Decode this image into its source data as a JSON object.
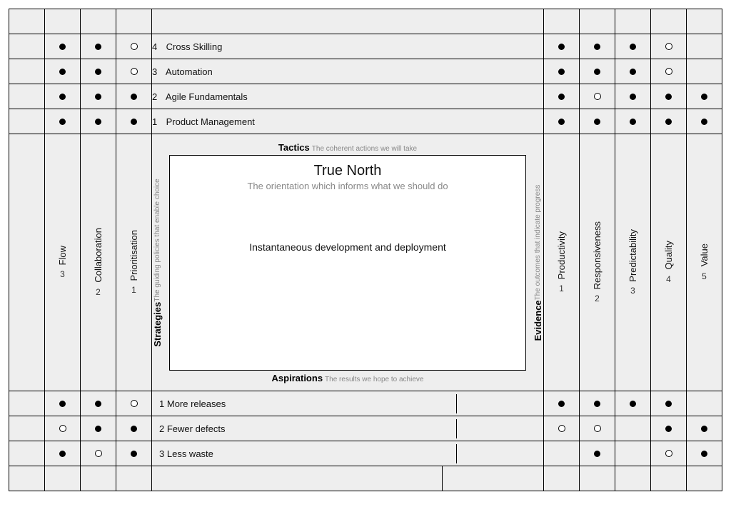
{
  "strategies": [
    {
      "num": "3",
      "name": "Flow"
    },
    {
      "num": "2",
      "name": "Collaboration"
    },
    {
      "num": "1",
      "name": "Prioritisation"
    }
  ],
  "evidence": [
    {
      "num": "1",
      "name": "Productivity"
    },
    {
      "num": "2",
      "name": "Responsiveness"
    },
    {
      "num": "3",
      "name": "Predictability"
    },
    {
      "num": "4",
      "name": "Quality"
    },
    {
      "num": "5",
      "name": "Value"
    }
  ],
  "tactics": [
    {
      "num": "4",
      "label": "Cross Skilling",
      "s": [
        "",
        "f",
        "f",
        "r"
      ],
      "e": [
        "f",
        "f",
        "f",
        "r",
        ""
      ]
    },
    {
      "num": "3",
      "label": "Automation",
      "s": [
        "",
        "f",
        "f",
        "r"
      ],
      "e": [
        "f",
        "f",
        "f",
        "r",
        ""
      ]
    },
    {
      "num": "2",
      "label": "Agile Fundamentals",
      "s": [
        "",
        "f",
        "f",
        "f"
      ],
      "e": [
        "f",
        "r",
        "f",
        "f",
        "f"
      ]
    },
    {
      "num": "1",
      "label": "Product Management",
      "s": [
        "",
        "f",
        "f",
        "f"
      ],
      "e": [
        "f",
        "f",
        "f",
        "f",
        "f"
      ]
    }
  ],
  "aspirations": [
    {
      "num": "1",
      "label": "More releases",
      "s": [
        "",
        "f",
        "f",
        "r"
      ],
      "e": [
        "f",
        "f",
        "f",
        "f",
        ""
      ]
    },
    {
      "num": "2",
      "label": "Fewer defects",
      "s": [
        "",
        "r",
        "f",
        "f"
      ],
      "e": [
        "r",
        "r",
        "",
        "f",
        "f"
      ]
    },
    {
      "num": "3",
      "label": "Less waste",
      "s": [
        "",
        "f",
        "r",
        "f"
      ],
      "e": [
        "",
        "f",
        "",
        "r",
        "f"
      ]
    }
  ],
  "edges": {
    "top": {
      "title": "Tactics",
      "sub": "The coherent actions we will take"
    },
    "left": {
      "title": "Strategies",
      "sub": "The guiding policies that enable choice"
    },
    "right": {
      "title": "Evidence",
      "sub": "The outcomes that indicate progress"
    },
    "bottom": {
      "title": "Aspirations",
      "sub": "The results we hope to achieve"
    }
  },
  "true_north": {
    "title": "True North",
    "subtitle": "The orientation which informs what we should do",
    "body": "Instantaneous development and deployment"
  },
  "chart_data": {
    "type": "table",
    "description": "X-matrix diagram. Filled dot = strong correlation, ring = weak correlation, blank = none.",
    "strategies": [
      "Flow",
      "Collaboration",
      "Prioritisation"
    ],
    "evidence": [
      "Productivity",
      "Responsiveness",
      "Predictability",
      "Quality",
      "Value"
    ],
    "tactics": {
      "Cross Skilling": {
        "strategies": {
          "Flow": null,
          "Collaboration": "strong",
          "Prioritisation": "strong",
          "_extra": "weak_rightmost"
        },
        "s_raw": [
          "",
          "strong",
          "strong",
          "weak"
        ],
        "evidence": {
          "Productivity": "strong",
          "Responsiveness": "strong",
          "Predictability": "strong",
          "Quality": "weak",
          "Value": null
        }
      },
      "Automation": {
        "s_raw": [
          "",
          "strong",
          "strong",
          "weak"
        ],
        "evidence": {
          "Productivity": "strong",
          "Responsiveness": "strong",
          "Predictability": "strong",
          "Quality": "weak",
          "Value": null
        }
      },
      "Agile Fundamentals": {
        "s_raw": [
          "",
          "strong",
          "strong",
          "strong"
        ],
        "evidence": {
          "Productivity": "strong",
          "Responsiveness": "weak",
          "Predictability": "strong",
          "Quality": "strong",
          "Value": "strong"
        }
      },
      "Product Management": {
        "s_raw": [
          "",
          "strong",
          "strong",
          "strong"
        ],
        "evidence": {
          "Productivity": "strong",
          "Responsiveness": "strong",
          "Predictability": "strong",
          "Quality": "strong",
          "Value": "strong"
        }
      }
    },
    "aspirations": {
      "More releases": {
        "s_raw": [
          "",
          "strong",
          "strong",
          "weak"
        ],
        "evidence": {
          "Productivity": "strong",
          "Responsiveness": "strong",
          "Predictability": "strong",
          "Quality": "strong",
          "Value": null
        }
      },
      "Fewer defects": {
        "s_raw": [
          "",
          "weak",
          "strong",
          "strong"
        ],
        "evidence": {
          "Productivity": "weak",
          "Responsiveness": "weak",
          "Predictability": null,
          "Quality": "strong",
          "Value": "strong"
        }
      },
      "Less waste": {
        "s_raw": [
          "",
          "strong",
          "weak",
          "strong"
        ],
        "evidence": {
          "Productivity": null,
          "Responsiveness": "strong",
          "Predictability": null,
          "Quality": "weak",
          "Value": "strong"
        }
      }
    }
  }
}
